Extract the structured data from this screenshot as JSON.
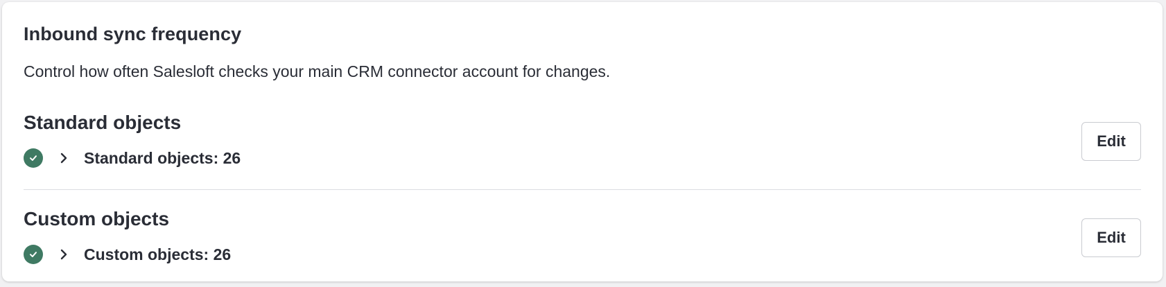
{
  "header": {
    "title": "Inbound sync frequency",
    "description": "Control how often Salesloft checks your main CRM connector account for changes."
  },
  "sections": [
    {
      "heading": "Standard objects",
      "status_label": "Standard objects: 26",
      "status_icon": "check-circle-icon",
      "expand_icon": "chevron-right-icon",
      "edit_label": "Edit"
    },
    {
      "heading": "Custom objects",
      "status_label": "Custom objects: 26",
      "status_icon": "check-circle-icon",
      "expand_icon": "chevron-right-icon",
      "edit_label": "Edit"
    }
  ],
  "colors": {
    "success": "#3f7a63",
    "text": "#2a2d36",
    "border": "#c9cbd0",
    "divider": "#dcdde1",
    "background": "#f1f1f3",
    "card": "#ffffff"
  }
}
